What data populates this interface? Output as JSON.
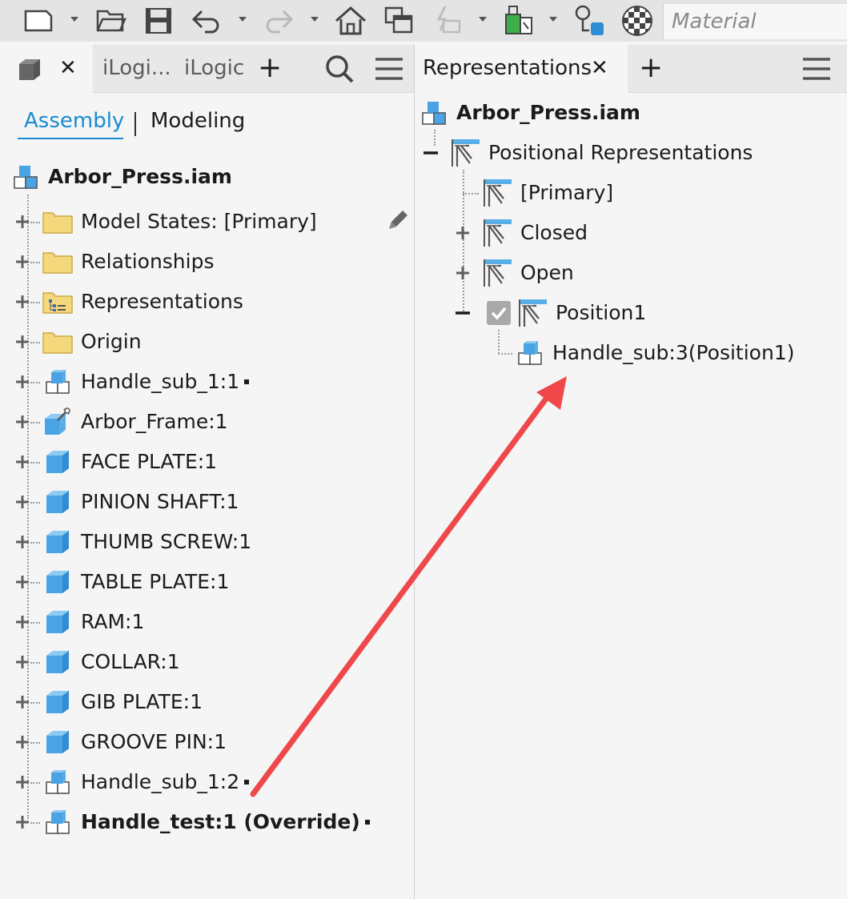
{
  "toolbar": {
    "material_placeholder": "Material",
    "icons": [
      "new-file-icon",
      "open-folder-icon",
      "save-icon",
      "undo-icon",
      "redo-icon",
      "home-icon",
      "copy-views-icon",
      "sketch-icon",
      "appearance-icon",
      "component-settings-icon",
      "material-sphere-icon"
    ]
  },
  "left_panel": {
    "tabs": {
      "close_label": "✕",
      "ilogic_truncated": "iLogi...",
      "ilogic": "iLogic",
      "add_label": "+"
    },
    "subtabs": {
      "assembly": "Assembly",
      "modeling": "Modeling"
    },
    "tree": {
      "root": "Arbor_Press.iam",
      "items": [
        {
          "label": "Model States: [Primary]",
          "icon": "folder-icon"
        },
        {
          "label": "Relationships",
          "icon": "folder-icon"
        },
        {
          "label": "Representations",
          "icon": "representations-folder-icon"
        },
        {
          "label": "Origin",
          "icon": "folder-icon"
        },
        {
          "label": "Handle_sub_1:1",
          "icon": "subassembly-icon",
          "marker": true
        },
        {
          "label": "Arbor_Frame:1",
          "icon": "grounded-part-icon"
        },
        {
          "label": "FACE PLATE:1",
          "icon": "part-icon"
        },
        {
          "label": "PINION SHAFT:1",
          "icon": "part-icon"
        },
        {
          "label": "THUMB SCREW:1",
          "icon": "part-icon"
        },
        {
          "label": "TABLE PLATE:1",
          "icon": "part-icon"
        },
        {
          "label": "RAM:1",
          "icon": "part-icon"
        },
        {
          "label": "COLLAR:1",
          "icon": "part-icon"
        },
        {
          "label": "GIB PLATE:1",
          "icon": "part-icon"
        },
        {
          "label": "GROOVE PIN:1",
          "icon": "part-icon"
        },
        {
          "label": "Handle_sub_1:2",
          "icon": "subassembly-icon",
          "marker": true
        },
        {
          "label": "Handle_test:1 (Override)",
          "icon": "subassembly-icon",
          "marker": true,
          "bold": true
        }
      ]
    }
  },
  "right_panel": {
    "tab_title": "Representations",
    "close_label": "✕",
    "add_label": "+",
    "tree": {
      "root": "Arbor_Press.iam",
      "positional": "Positional Representations",
      "children": [
        "[Primary]",
        "Closed",
        "Open",
        "Position1"
      ],
      "position1_child": "Handle_sub:3(Position1)"
    }
  },
  "colors": {
    "accent": "#1a8bd3",
    "arrow": "#f0474b",
    "folder": "#f6d87c",
    "part_blue": "#5aaee8"
  }
}
